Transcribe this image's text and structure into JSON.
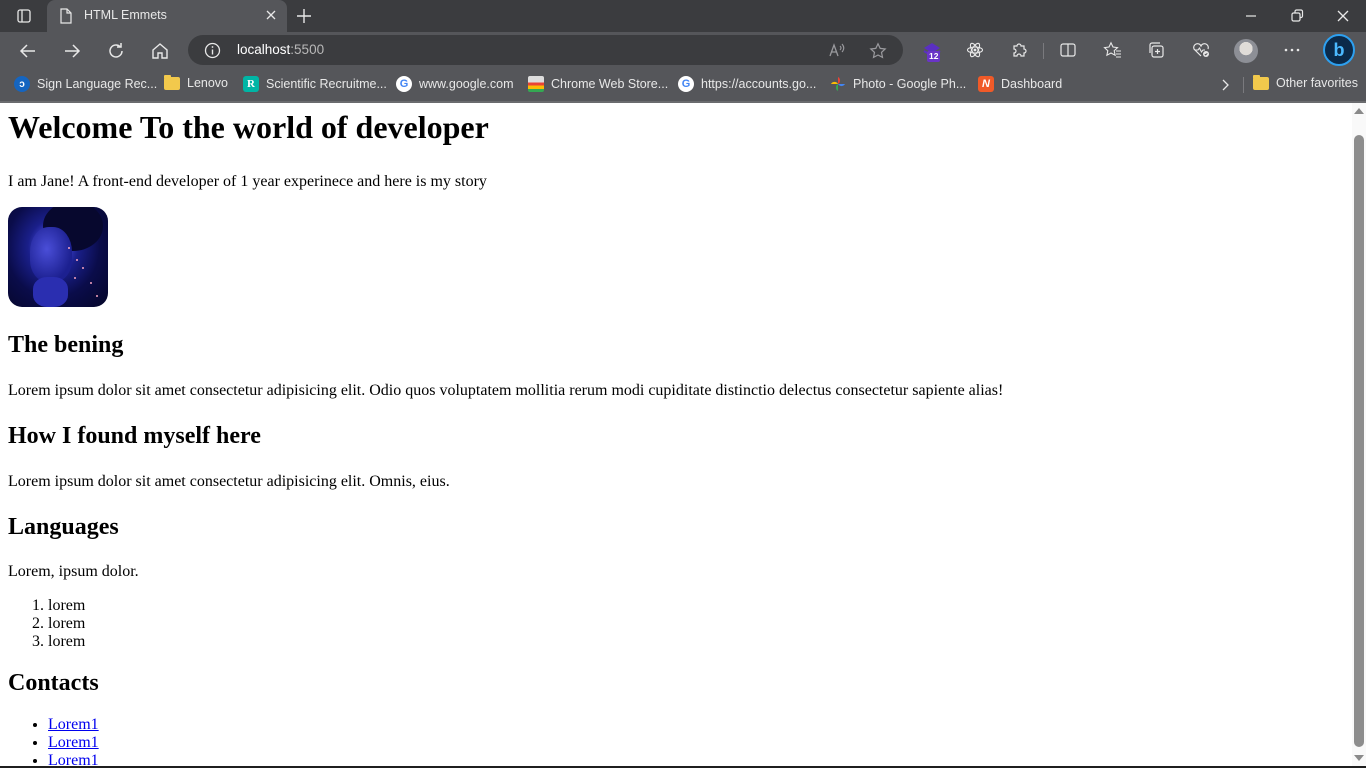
{
  "browser": {
    "tab": {
      "title": "HTML Emmets",
      "icon": "page-icon"
    },
    "address": {
      "host": "localhost",
      "port": ":5500"
    },
    "extension_badge": "12",
    "bookmarks": [
      {
        "label": "Sign Language Rec...",
        "icon": "sign-language-icon"
      },
      {
        "label": "Lenovo",
        "icon": "folder-icon"
      },
      {
        "label": "Scientific Recruitme...",
        "icon": "rg-icon"
      },
      {
        "label": "www.google.com",
        "icon": "google-icon"
      },
      {
        "label": "Chrome Web Store...",
        "icon": "chrome-web-store-icon"
      },
      {
        "label": "https://accounts.go...",
        "icon": "google-icon"
      },
      {
        "label": "Photo - Google Ph...",
        "icon": "google-photos-icon"
      },
      {
        "label": "Dashboard",
        "icon": "dashboard-icon"
      }
    ],
    "other_favorites": "Other favorites"
  },
  "page": {
    "title": "Welcome To the world of developer",
    "intro": "I am Jane! A front-end developer of 1 year experinece and here is my story",
    "image_alt": "Profile photo",
    "sections": [
      {
        "heading": "The bening",
        "text": "Lorem ipsum dolor sit amet consectetur adipisicing elit. Odio quos voluptatem mollitia rerum modi cupiditate distinctio delectus consectetur sapiente alias!"
      },
      {
        "heading": "How I found myself here",
        "text": "Lorem ipsum dolor sit amet consectetur adipisicing elit. Omnis, eius."
      },
      {
        "heading": "Languages",
        "text": "Lorem, ipsum dolor."
      }
    ],
    "languages": [
      "lorem",
      "lorem",
      "lorem"
    ],
    "contacts_heading": "Contacts",
    "contacts": [
      "Lorem1",
      "Lorem1",
      "Lorem1"
    ]
  }
}
